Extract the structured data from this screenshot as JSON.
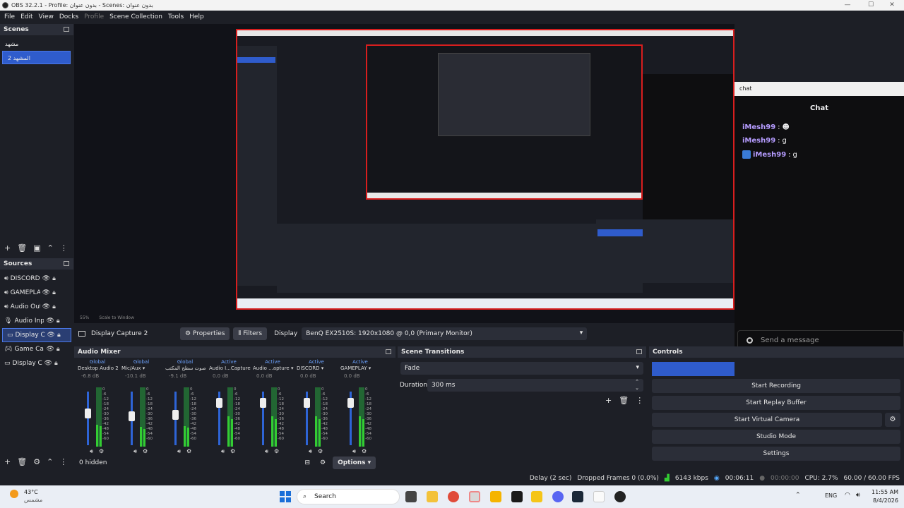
{
  "window": {
    "title": "OBS 32.2.1 - Profile: بدون عنوان - Scenes: بدون عنوان"
  },
  "menu": [
    "File",
    "Edit",
    "View",
    "Docks",
    "Profile",
    "Scene Collection",
    "Tools",
    "Help"
  ],
  "scenes": {
    "title": "Scenes",
    "items": [
      "مشهد",
      "المشهد 2"
    ],
    "selected_index": 1
  },
  "sources": {
    "title": "Sources",
    "items": [
      "DISCORD",
      "GAMEPLA",
      "Audio Out",
      "Audio Inp",
      "Display Ca",
      "Game Cap",
      "Display Ca"
    ],
    "selected_index": 4
  },
  "source_bar": {
    "source_name": "Display Capture 2",
    "properties": "Properties",
    "filters": "Filters",
    "display_label": "Display",
    "display_value": "BenQ EX2510S: 1920x1080 @ 0,0 (Primary Monitor)"
  },
  "zoom": {
    "percent": "55%",
    "mode": "Scale to Window"
  },
  "chat": {
    "window_title": "chat",
    "title": "Chat",
    "messages": [
      {
        "user": "iMesh99",
        "text": ""
      },
      {
        "user": "iMesh99",
        "text": "g"
      },
      {
        "user": "iMesh99",
        "text": "g"
      }
    ],
    "input_placeholder": "Send a message"
  },
  "mixer": {
    "title": "Audio Mixer",
    "hidden": "0 hidden",
    "options": "Options",
    "scale": [
      "0",
      "-6",
      "-12",
      "-18",
      "-24",
      "-30",
      "-36",
      "-42",
      "-48",
      "-54",
      "-60"
    ],
    "strips": [
      {
        "scope": "Global",
        "name": "Desktop Audio 2",
        "db": "-6.8 dB",
        "level": 0.62
      },
      {
        "scope": "Global",
        "name": "Mic/Aux",
        "db": "-10.1 dB",
        "level": 0.55
      },
      {
        "scope": "Global",
        "name": "صوت سطح المكتب",
        "db": "-9.1 dB",
        "level": 0.58
      },
      {
        "scope": "Active",
        "name": "Audio I...Capture",
        "db": "0.0 dB",
        "level": 0.85
      },
      {
        "scope": "Active",
        "name": "Audio ...apture",
        "db": "0.0 dB",
        "level": 0.85
      },
      {
        "scope": "Active",
        "name": "DISCORD",
        "db": "0.0 dB",
        "level": 0.85
      },
      {
        "scope": "Active",
        "name": "GAMEPLAY",
        "db": "0.0 dB",
        "level": 0.85
      }
    ]
  },
  "transitions": {
    "title": "Scene Transitions",
    "type": "Fade",
    "duration_label": "Duration",
    "duration_value": "300 ms"
  },
  "controls": {
    "title": "Controls",
    "buttons": [
      "Start Recording",
      "Start Replay Buffer",
      "Start Virtual Camera",
      "Studio Mode",
      "Settings"
    ]
  },
  "status": {
    "delay": "Delay (2 sec)",
    "dropped": "Dropped Frames 0 (0.0%)",
    "kbps": "6143 kbps",
    "stream_time": "00:06:11",
    "rec_time": "00:00:00",
    "cpu": "CPU: 2.7%",
    "fps": "60.00 / 60.00 FPS"
  },
  "taskbar": {
    "temp": "43°C",
    "weather": "مشمس",
    "search": "Search",
    "lang": "ENG",
    "time": "11:55 AM",
    "date": "8/4/2026"
  },
  "colors": {
    "accent": "#2f5ccc",
    "live_border": "#d81e1e",
    "bg": "#1d1f26"
  }
}
